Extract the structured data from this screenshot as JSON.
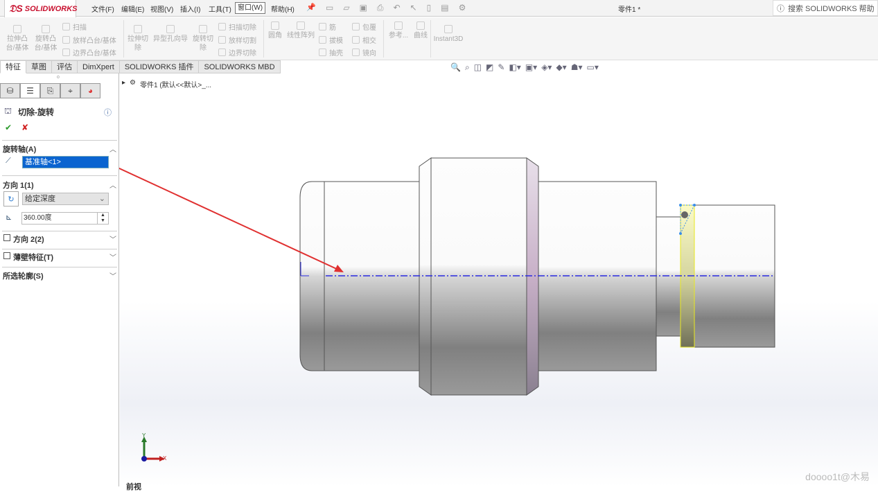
{
  "app": {
    "logo": "SOLIDWORKS",
    "doc_title": "零件1 *",
    "search_placeholder": "搜索 SOLIDWORKS 帮助"
  },
  "menu": [
    "文件(F)",
    "编辑(E)",
    "视图(V)",
    "插入(I)",
    "工具(T)",
    "窗口(W)",
    "帮助(H)"
  ],
  "ribbon": {
    "extrude_boss": "拉伸凸台/基体",
    "revolve_boss": "旋转凸台/基体",
    "sweep": "扫描",
    "loft": "放样凸台/基体",
    "boundary": "边界凸台/基体",
    "extrude_cut": "拉伸切除",
    "hole_wizard": "异型孔向导",
    "revolve_cut": "旋转切除",
    "sweep_cut": "扫描切除",
    "loft_cut": "放样切割",
    "boundary_cut": "边界切除",
    "fillet": "圆角",
    "linear_pattern": "线性阵列",
    "rib": "筋",
    "draft": "拔模",
    "shell": "抽壳",
    "wrap": "包覆",
    "intersect": "相交",
    "mirror": "镜向",
    "reference": "参考...",
    "curves": "曲线",
    "instant3d": "Instant3D"
  },
  "tabs": [
    "特征",
    "草图",
    "评估",
    "DimXpert",
    "SOLIDWORKS 插件",
    "SOLIDWORKS MBD"
  ],
  "tree": {
    "root": "零件1  (默认<<默认>_..."
  },
  "feature": {
    "title": "切除-旋转",
    "axis_section": "旋转轴(A)",
    "axis_value": "基准轴<1>",
    "dir1_section": "方向 1(1)",
    "dir1_type": "给定深度",
    "dir1_angle": "360.00度",
    "dir2_section": "方向 2(2)",
    "thin_section": "薄壁特征(T)",
    "contours_section": "所选轮廓(S)"
  },
  "triad": {
    "x": "X",
    "y": "Y"
  },
  "view_label": "前视",
  "watermark": "doooo1t@木易",
  "colors": {
    "accent": "#0a64d0",
    "arrow": "#e03030",
    "axis": "#2a2ae0",
    "highlight": "#f6f6a0"
  }
}
